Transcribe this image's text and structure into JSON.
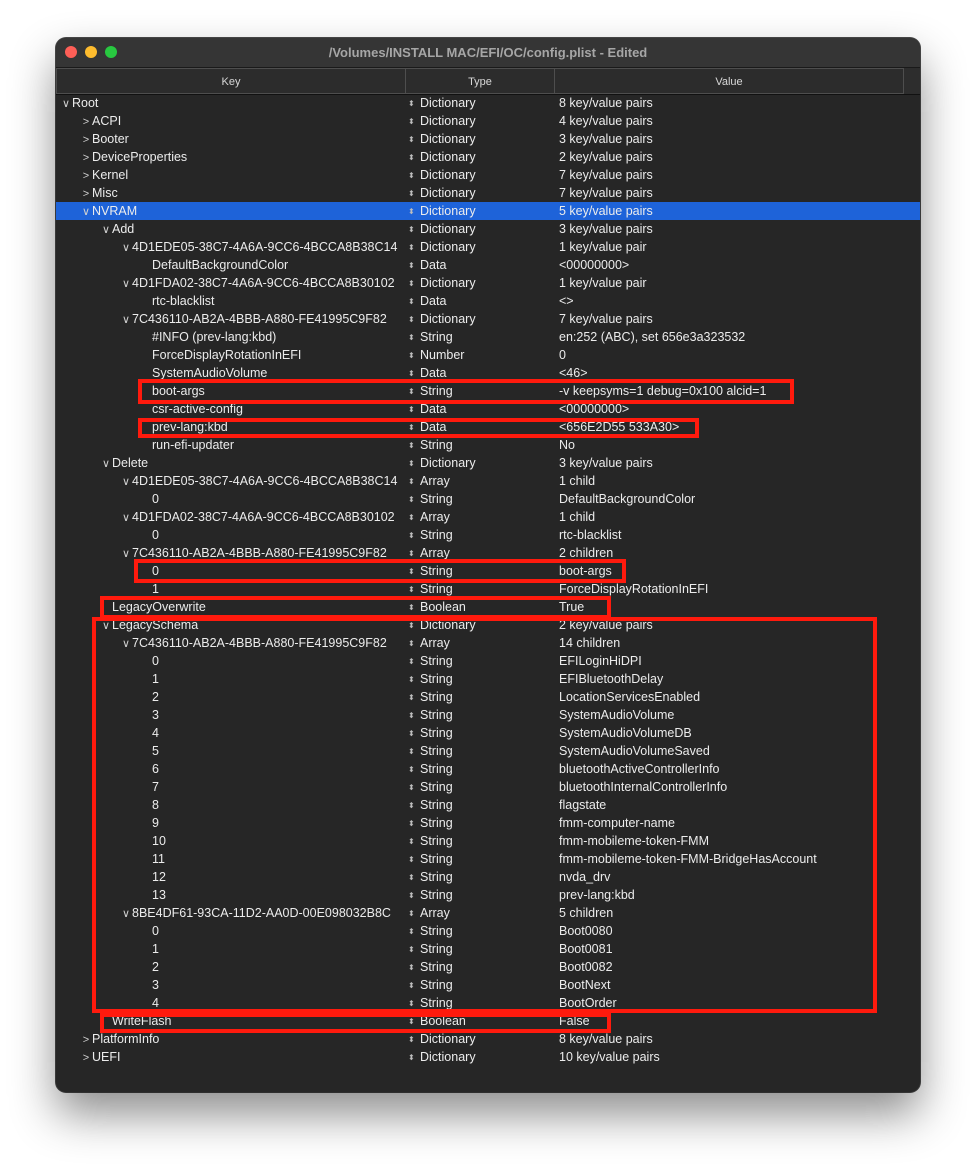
{
  "window": {
    "title": "/Volumes/INSTALL MAC/EFI/OC/config.plist - Edited"
  },
  "columns": {
    "key": "Key",
    "type": "Type",
    "value": "Value"
  },
  "icons": {
    "expanded": "chevron-down-icon",
    "collapsed": "chevron-right-icon",
    "type_popup": "up-down-arrows-icon"
  },
  "colors": {
    "selection": "#1e63d9",
    "annotation": "#ff1a0d",
    "background": "#262626"
  },
  "rows": [
    {
      "depth": 0,
      "disc": "v",
      "key": "Root",
      "type": "Dictionary",
      "value": "8 key/value pairs"
    },
    {
      "depth": 1,
      "disc": ">",
      "key": "ACPI",
      "type": "Dictionary",
      "value": "4 key/value pairs"
    },
    {
      "depth": 1,
      "disc": ">",
      "key": "Booter",
      "type": "Dictionary",
      "value": "3 key/value pairs"
    },
    {
      "depth": 1,
      "disc": ">",
      "key": "DeviceProperties",
      "type": "Dictionary",
      "value": "2 key/value pairs"
    },
    {
      "depth": 1,
      "disc": ">",
      "key": "Kernel",
      "type": "Dictionary",
      "value": "7 key/value pairs"
    },
    {
      "depth": 1,
      "disc": ">",
      "key": "Misc",
      "type": "Dictionary",
      "value": "7 key/value pairs"
    },
    {
      "depth": 1,
      "disc": "v",
      "key": "NVRAM",
      "type": "Dictionary",
      "value": "5 key/value pairs",
      "selected": true
    },
    {
      "depth": 2,
      "disc": "v",
      "key": "Add",
      "type": "Dictionary",
      "value": "3 key/value pairs"
    },
    {
      "depth": 3,
      "disc": "v",
      "key": "4D1EDE05-38C7-4A6A-9CC6-4BCCA8B38C14",
      "type": "Dictionary",
      "value": "1 key/value pair"
    },
    {
      "depth": 4,
      "disc": "",
      "key": "DefaultBackgroundColor",
      "type": "Data",
      "value": "<00000000>"
    },
    {
      "depth": 3,
      "disc": "v",
      "key": "4D1FDA02-38C7-4A6A-9CC6-4BCCA8B30102",
      "type": "Dictionary",
      "value": "1 key/value pair"
    },
    {
      "depth": 4,
      "disc": "",
      "key": "rtc-blacklist",
      "type": "Data",
      "value": "<>"
    },
    {
      "depth": 3,
      "disc": "v",
      "key": "7C436110-AB2A-4BBB-A880-FE41995C9F82",
      "type": "Dictionary",
      "value": "7 key/value pairs"
    },
    {
      "depth": 4,
      "disc": "",
      "key": "#INFO (prev-lang:kbd)",
      "type": "String",
      "value": "en:252 (ABC), set 656e3a323532"
    },
    {
      "depth": 4,
      "disc": "",
      "key": "ForceDisplayRotationInEFI",
      "type": "Number",
      "value": "0"
    },
    {
      "depth": 4,
      "disc": "",
      "key": "SystemAudioVolume",
      "type": "Data",
      "value": "<46>"
    },
    {
      "depth": 4,
      "disc": "",
      "key": "boot-args",
      "type": "String",
      "value": "-v keepsyms=1 debug=0x100 alcid=1"
    },
    {
      "depth": 4,
      "disc": "",
      "key": "csr-active-config",
      "type": "Data",
      "value": "<00000000>"
    },
    {
      "depth": 4,
      "disc": "",
      "key": "prev-lang:kbd",
      "type": "Data",
      "value": "<656E2D55 533A30>"
    },
    {
      "depth": 4,
      "disc": "",
      "key": "run-efi-updater",
      "type": "String",
      "value": "No"
    },
    {
      "depth": 2,
      "disc": "v",
      "key": "Delete",
      "type": "Dictionary",
      "value": "3 key/value pairs"
    },
    {
      "depth": 3,
      "disc": "v",
      "key": "4D1EDE05-38C7-4A6A-9CC6-4BCCA8B38C14",
      "type": "Array",
      "value": "1 child"
    },
    {
      "depth": 4,
      "disc": "",
      "key": "0",
      "type": "String",
      "value": "DefaultBackgroundColor"
    },
    {
      "depth": 3,
      "disc": "v",
      "key": "4D1FDA02-38C7-4A6A-9CC6-4BCCA8B30102",
      "type": "Array",
      "value": "1 child"
    },
    {
      "depth": 4,
      "disc": "",
      "key": "0",
      "type": "String",
      "value": "rtc-blacklist"
    },
    {
      "depth": 3,
      "disc": "v",
      "key": "7C436110-AB2A-4BBB-A880-FE41995C9F82",
      "type": "Array",
      "value": "2 children"
    },
    {
      "depth": 4,
      "disc": "",
      "key": "0",
      "type": "String",
      "value": "boot-args"
    },
    {
      "depth": 4,
      "disc": "",
      "key": "1",
      "type": "String",
      "value": "ForceDisplayRotationInEFI"
    },
    {
      "depth": 2,
      "disc": "",
      "key": "LegacyOverwrite",
      "type": "Boolean",
      "value": "True"
    },
    {
      "depth": 2,
      "disc": "v",
      "key": "LegacySchema",
      "type": "Dictionary",
      "value": "2 key/value pairs"
    },
    {
      "depth": 3,
      "disc": "v",
      "key": "7C436110-AB2A-4BBB-A880-FE41995C9F82",
      "type": "Array",
      "value": "14 children"
    },
    {
      "depth": 4,
      "disc": "",
      "key": "0",
      "type": "String",
      "value": "EFILoginHiDPI"
    },
    {
      "depth": 4,
      "disc": "",
      "key": "1",
      "type": "String",
      "value": "EFIBluetoothDelay"
    },
    {
      "depth": 4,
      "disc": "",
      "key": "2",
      "type": "String",
      "value": "LocationServicesEnabled"
    },
    {
      "depth": 4,
      "disc": "",
      "key": "3",
      "type": "String",
      "value": "SystemAudioVolume"
    },
    {
      "depth": 4,
      "disc": "",
      "key": "4",
      "type": "String",
      "value": "SystemAudioVolumeDB"
    },
    {
      "depth": 4,
      "disc": "",
      "key": "5",
      "type": "String",
      "value": "SystemAudioVolumeSaved"
    },
    {
      "depth": 4,
      "disc": "",
      "key": "6",
      "type": "String",
      "value": "bluetoothActiveControllerInfo"
    },
    {
      "depth": 4,
      "disc": "",
      "key": "7",
      "type": "String",
      "value": "bluetoothInternalControllerInfo"
    },
    {
      "depth": 4,
      "disc": "",
      "key": "8",
      "type": "String",
      "value": "flagstate"
    },
    {
      "depth": 4,
      "disc": "",
      "key": "9",
      "type": "String",
      "value": "fmm-computer-name"
    },
    {
      "depth": 4,
      "disc": "",
      "key": "10",
      "type": "String",
      "value": "fmm-mobileme-token-FMM"
    },
    {
      "depth": 4,
      "disc": "",
      "key": "11",
      "type": "String",
      "value": "fmm-mobileme-token-FMM-BridgeHasAccount"
    },
    {
      "depth": 4,
      "disc": "",
      "key": "12",
      "type": "String",
      "value": "nvda_drv"
    },
    {
      "depth": 4,
      "disc": "",
      "key": "13",
      "type": "String",
      "value": "prev-lang:kbd"
    },
    {
      "depth": 3,
      "disc": "v",
      "key": "8BE4DF61-93CA-11D2-AA0D-00E098032B8C",
      "type": "Array",
      "value": "5 children"
    },
    {
      "depth": 4,
      "disc": "",
      "key": "0",
      "type": "String",
      "value": "Boot0080"
    },
    {
      "depth": 4,
      "disc": "",
      "key": "1",
      "type": "String",
      "value": "Boot0081"
    },
    {
      "depth": 4,
      "disc": "",
      "key": "2",
      "type": "String",
      "value": "Boot0082"
    },
    {
      "depth": 4,
      "disc": "",
      "key": "3",
      "type": "String",
      "value": "BootNext"
    },
    {
      "depth": 4,
      "disc": "",
      "key": "4",
      "type": "String",
      "value": "BootOrder"
    },
    {
      "depth": 2,
      "disc": "",
      "key": "WriteFlash",
      "type": "Boolean",
      "value": "False"
    },
    {
      "depth": 1,
      "disc": ">",
      "key": "PlatformInfo",
      "type": "Dictionary",
      "value": "8 key/value pairs"
    },
    {
      "depth": 1,
      "disc": ">",
      "key": "UEFI",
      "type": "Dictionary",
      "value": "10 key/value pairs"
    }
  ]
}
